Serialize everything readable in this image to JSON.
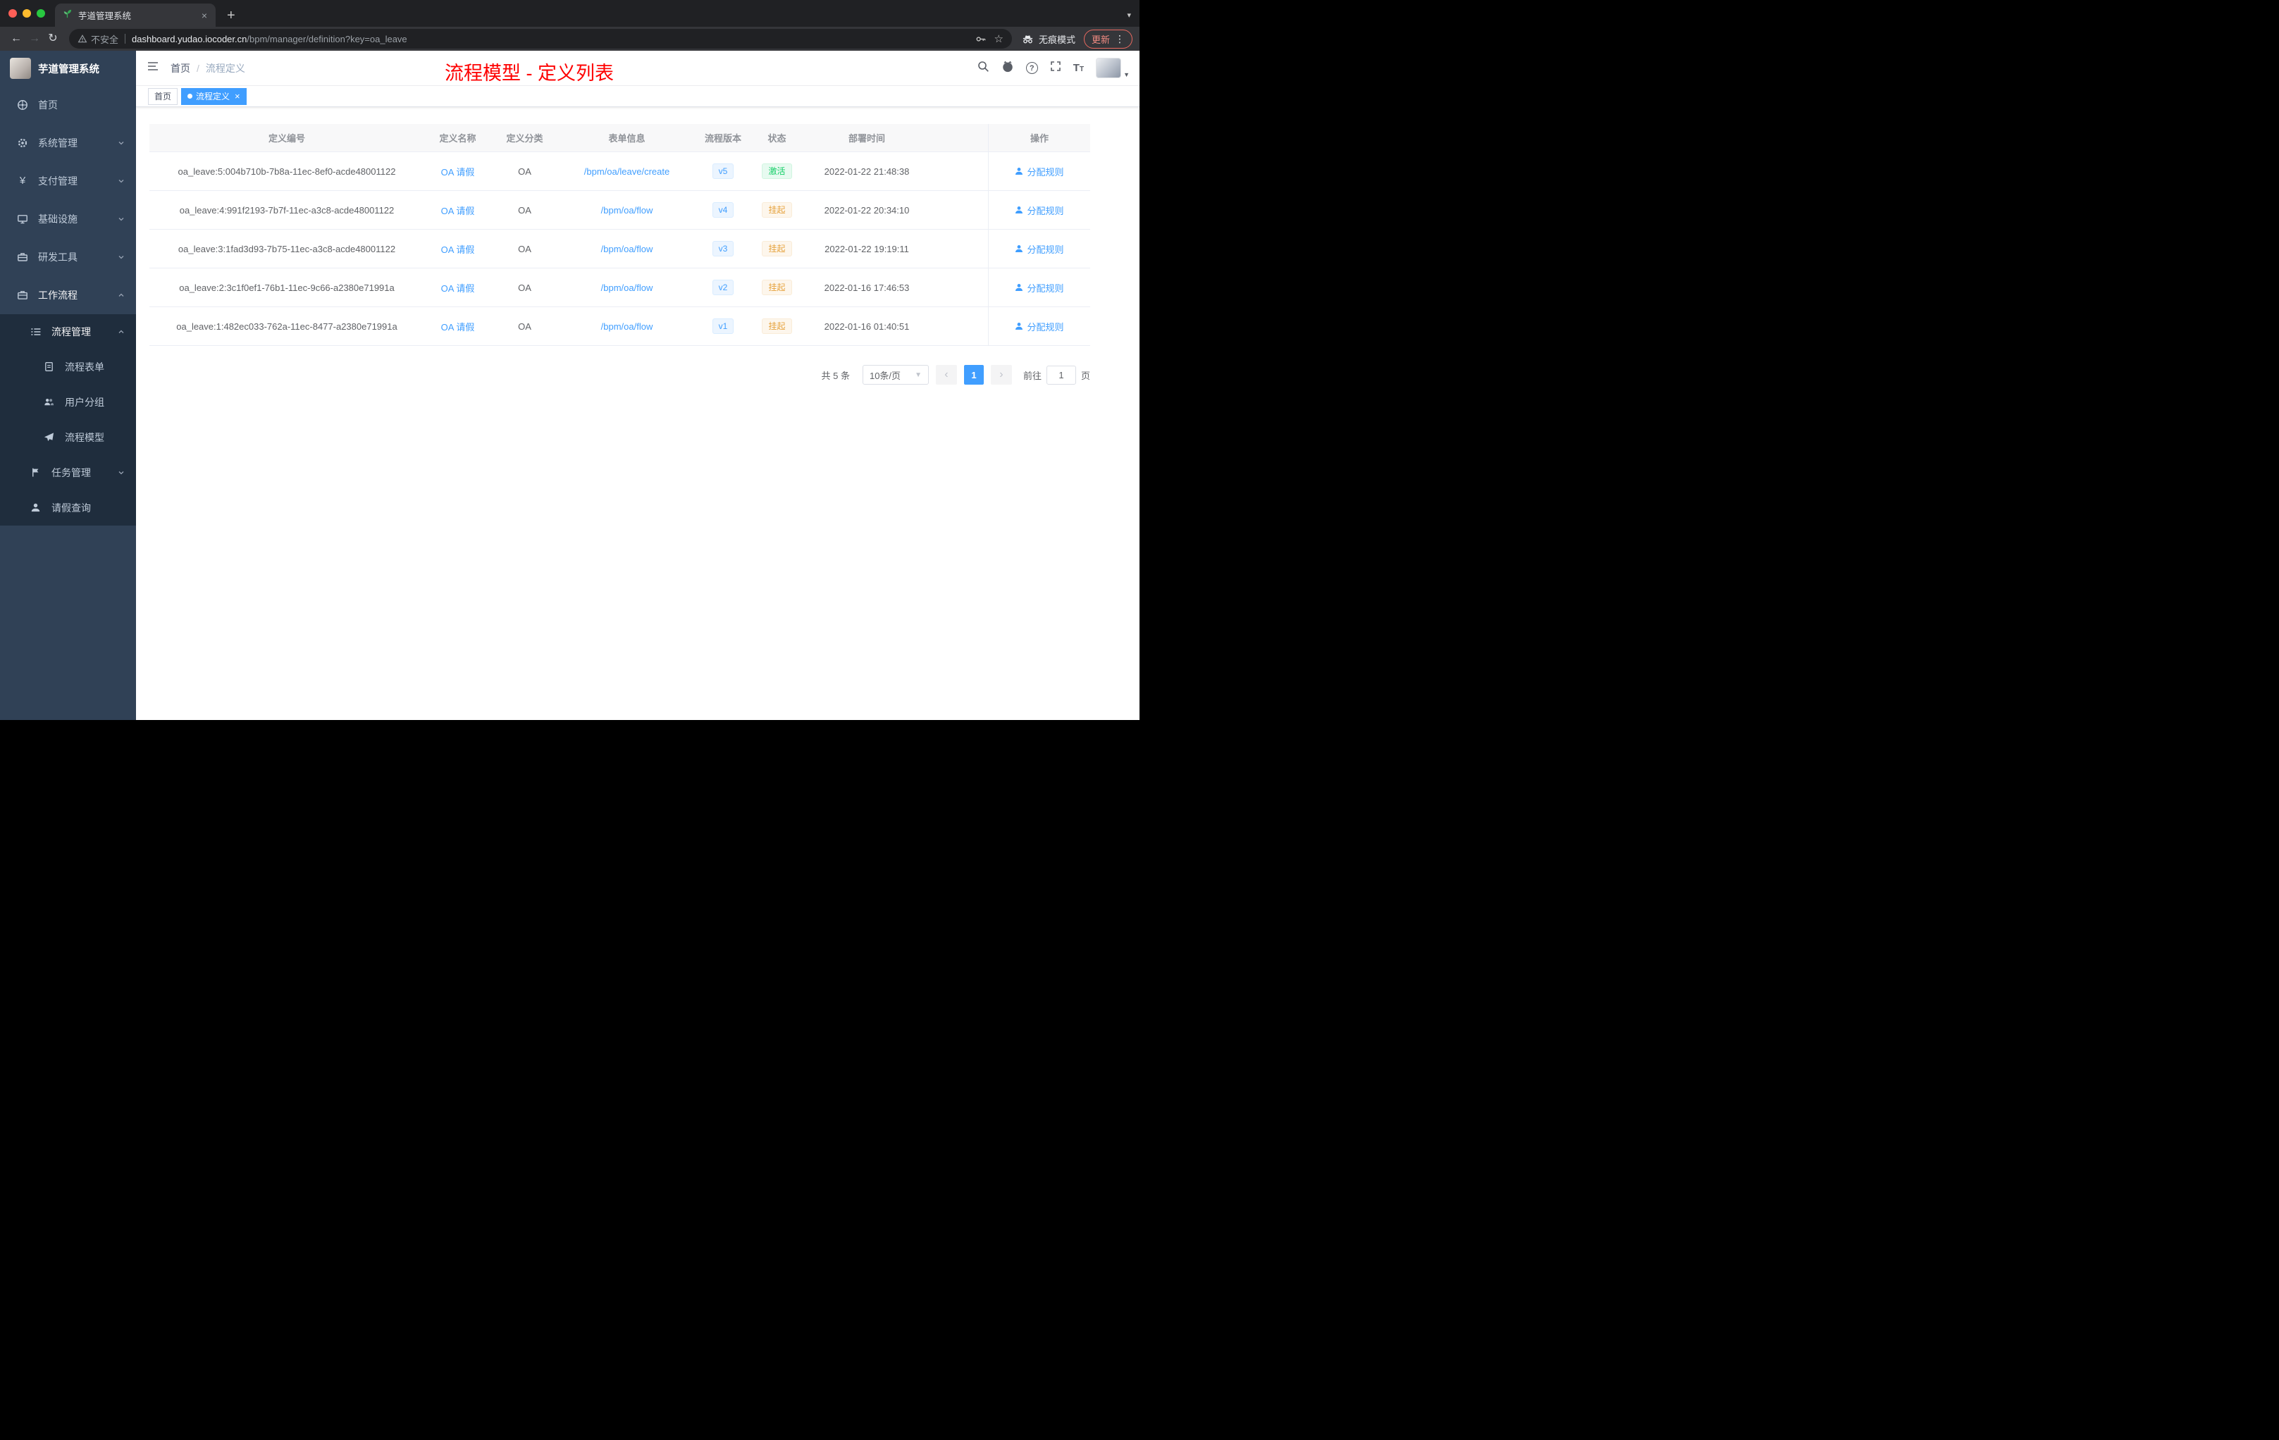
{
  "browser": {
    "tab_title": "芋道管理系统",
    "security_label": "不安全",
    "url_domain": "dashboard.yudao.iocoder.cn",
    "url_path": "/bpm/manager/definition?key=oa_leave",
    "incognito_label": "无痕模式",
    "update_label": "更新"
  },
  "sidebar": {
    "logo_title": "芋道管理系统",
    "items": [
      {
        "label": "首页"
      },
      {
        "label": "系统管理"
      },
      {
        "label": "支付管理"
      },
      {
        "label": "基础设施"
      },
      {
        "label": "研发工具"
      },
      {
        "label": "工作流程"
      },
      {
        "label": "流程管理"
      },
      {
        "label": "流程表单"
      },
      {
        "label": "用户分组"
      },
      {
        "label": "流程模型"
      },
      {
        "label": "任务管理"
      },
      {
        "label": "请假查询"
      }
    ]
  },
  "header": {
    "breadcrumb_home": "首页",
    "breadcrumb_sep": "/",
    "breadcrumb_current": "流程定义",
    "annotation": "流程模型 - 定义列表"
  },
  "tags": {
    "home": "首页",
    "active": "流程定义"
  },
  "table": {
    "columns": {
      "id": "定义编号",
      "name": "定义名称",
      "category": "定义分类",
      "form": "表单信息",
      "version": "流程版本",
      "status": "状态",
      "deploy_time": "部署时间",
      "actions": "操作"
    },
    "rows": [
      {
        "id": "oa_leave:5:004b710b-7b8a-11ec-8ef0-acde48001122",
        "name": "OA 请假",
        "category": "OA",
        "form": "/bpm/oa/leave/create",
        "version": "v5",
        "status": "激活",
        "deploy_time": "2022-01-22 21:48:38",
        "action": "分配规则"
      },
      {
        "id": "oa_leave:4:991f2193-7b7f-11ec-a3c8-acde48001122",
        "name": "OA 请假",
        "category": "OA",
        "form": "/bpm/oa/flow",
        "version": "v4",
        "status": "挂起",
        "deploy_time": "2022-01-22 20:34:10",
        "action": "分配规则"
      },
      {
        "id": "oa_leave:3:1fad3d93-7b75-11ec-a3c8-acde48001122",
        "name": "OA 请假",
        "category": "OA",
        "form": "/bpm/oa/flow",
        "version": "v3",
        "status": "挂起",
        "deploy_time": "2022-01-22 19:19:11",
        "action": "分配规则"
      },
      {
        "id": "oa_leave:2:3c1f0ef1-76b1-11ec-9c66-a2380e71991a",
        "name": "OA 请假",
        "category": "OA",
        "form": "/bpm/oa/flow",
        "version": "v2",
        "status": "挂起",
        "deploy_time": "2022-01-16 17:46:53",
        "action": "分配规则"
      },
      {
        "id": "oa_leave:1:482ec033-762a-11ec-8477-a2380e71991a",
        "name": "OA 请假",
        "category": "OA",
        "form": "/bpm/oa/flow",
        "version": "v1",
        "status": "挂起",
        "deploy_time": "2022-01-16 01:40:51",
        "action": "分配规则"
      }
    ]
  },
  "pagination": {
    "total": "共 5 条",
    "page_size": "10条/页",
    "prev": "‹",
    "current_page": "1",
    "next": "›",
    "goto_label": "前往",
    "goto_value": "1",
    "goto_unit": "页"
  },
  "colors": {
    "accent_blue": "#409eff",
    "status_active_text": "#13ce66",
    "status_suspended_text": "#e6a23c",
    "annotation_red": "#fe0000",
    "sidebar_bg": "#304156",
    "sidebar_submenu_bg": "#1f2d3d"
  }
}
